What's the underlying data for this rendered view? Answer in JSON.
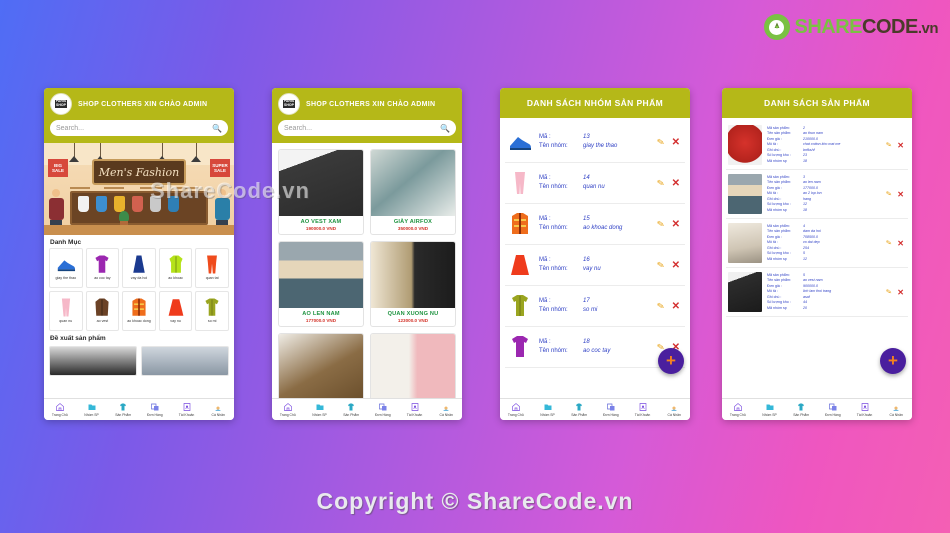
{
  "brand": {
    "share": "SHARE",
    "code": "CODE",
    "vn": ".vn",
    "mark_icon": "recycle-leaf-icon"
  },
  "watermarks": {
    "middle": "ShareCode.vn",
    "bottom": "Copyright © ShareCode.vn"
  },
  "bottom_nav": [
    {
      "label": "Trang Chủ",
      "icon": "home-icon"
    },
    {
      "label": "Nhóm SP",
      "icon": "folder-icon"
    },
    {
      "label": "Sản Phẩm",
      "icon": "tshirt-icon"
    },
    {
      "label": "Đơn Hàng",
      "icon": "orders-icon"
    },
    {
      "label": "Tài Khoản",
      "icon": "account-icon"
    },
    {
      "label": "Cá Nhân",
      "icon": "avatar-icon"
    }
  ],
  "phone1": {
    "header": {
      "title": "SHOP CLOTHERS XIN CHÀO ADMIN",
      "logo": "PARIS SHOP LOGO"
    },
    "search": {
      "placeholder": "Search...",
      "icon": "search-icon"
    },
    "banner": {
      "sign": "Men's Fashion",
      "sale_left": "BIG SALE",
      "sale_right": "SUPER SALE"
    },
    "section_categories": "Danh Mục",
    "categories": [
      {
        "label": "giay the thao",
        "icon": "sneaker-icon",
        "color": "#2a6fd6"
      },
      {
        "label": "ao coc tay",
        "icon": "tshirt-icon",
        "color": "#9b27b0"
      },
      {
        "label": "vay da hoi",
        "icon": "gown-icon",
        "color": "#1b3a8f"
      },
      {
        "label": "ao khoac",
        "icon": "jacket-icon",
        "color": "#b5e21a"
      },
      {
        "label": "quan tat",
        "icon": "tights-icon",
        "color": "#ef4b1c"
      },
      {
        "label": "quan nu",
        "icon": "pants-icon",
        "color": "#f6b8c8"
      },
      {
        "label": "ao vest",
        "icon": "coat-icon",
        "color": "#6b4226"
      },
      {
        "label": "ao khoac dong",
        "icon": "winter-jacket-icon",
        "color": "#ef6d1c"
      },
      {
        "label": "vay nu",
        "icon": "skirt-icon",
        "color": "#ef3b1c"
      },
      {
        "label": "so mi",
        "icon": "shirt-icon",
        "color": "#9aa520"
      }
    ],
    "section_suggested": "Đề xuất sản phẩm"
  },
  "phone2": {
    "header": {
      "title": "SHOP CLOTHERS XIN CHÀO ADMIN",
      "logo": "PARIS SHOP LOGO"
    },
    "search": {
      "placeholder": "Search...",
      "icon": "search-icon"
    },
    "products": [
      {
        "name": "AO VEST XAM",
        "price": "190000.0 VND",
        "image": "grey-blazer-photo"
      },
      {
        "name": "GIÀY AIRFOX",
        "price": "350000.0 VND",
        "image": "sneakers-photo"
      },
      {
        "name": "AO LEN NAM",
        "price": "177000.0 VND",
        "image": "striped-sweater-photo"
      },
      {
        "name": "QUAN XUONG NU",
        "price": "123000.0 VND",
        "image": "wide-trousers-photo"
      },
      {
        "name": "",
        "price": "",
        "image": "brown-coat-photo"
      },
      {
        "name": "",
        "price": "",
        "image": "pink-shirts-photo"
      }
    ]
  },
  "phone3": {
    "header_title": "DANH SÁCH NHÓM SẢN PHẨM",
    "labels": {
      "ma": "Mã :",
      "ten_nhom": "Tên nhóm:"
    },
    "groups": [
      {
        "ma": "13",
        "ten_nhom": "giay the thao",
        "icon": "sneaker-icon",
        "color": "#2a6fd6"
      },
      {
        "ma": "14",
        "ten_nhom": "quan nu",
        "icon": "pants-icon",
        "color": "#f6b8c8"
      },
      {
        "ma": "15",
        "ten_nhom": "ao khoac dong",
        "icon": "winter-jacket-icon",
        "color": "#ef6d1c"
      },
      {
        "ma": "16",
        "ten_nhom": "vay nu",
        "icon": "skirt-icon",
        "color": "#ef3b1c"
      },
      {
        "ma": "17",
        "ten_nhom": "so mi",
        "icon": "shirt-icon",
        "color": "#9aa520"
      },
      {
        "ma": "18",
        "ten_nhom": "ao coc tay",
        "icon": "tshirt-icon",
        "color": "#9b27b0"
      }
    ],
    "edit_icon": "pencil-icon",
    "delete_icon": "close-x-icon",
    "fab": "+"
  },
  "phone4": {
    "header_title": "DANH SÁCH  SẢN PHẨM",
    "labels": {
      "ma_sp": "Mã sản phẩm:",
      "ten_sp": "Tên sản phẩm:",
      "don_gia": "Đơn giá :",
      "mo_ta": "Mô tả :",
      "ghi_chu": "Ghi chú :",
      "so_luong": "Số lượng kho :",
      "ma_nhom": "Mã nhóm sp"
    },
    "products": [
      {
        "ma_sp": "2",
        "ten_sp": "ao thun nam",
        "don_gia": "210000.0",
        "mo_ta": "chat cotton kho mat me",
        "ghi_chu": "bnfkshf",
        "so_luong": "23",
        "ma_nhom": "18",
        "image": "red-tshirt-photo"
      },
      {
        "ma_sp": "3",
        "ten_sp": "ao len nam",
        "don_gia": "177000.0",
        "mo_ta": "ao 2 lop lon",
        "ghi_chu": "hang",
        "so_luong": "12",
        "ma_nhom": "18",
        "image": "striped-sweater-photo"
      },
      {
        "ma_sp": "4",
        "ten_sp": "dam da hoi",
        "don_gia": "708500.0",
        "mo_ta": "vo dai dep",
        "ghi_chu": "254",
        "so_luong": "5",
        "ma_nhom": "12",
        "image": "beige-dress-photo"
      },
      {
        "ma_sp": "5",
        "ten_sp": "ao vest nam",
        "don_gia": "900000.0",
        "mo_ta": "lich lam thoi trang",
        "ghi_chu": "asaf",
        "so_luong": "44",
        "ma_nhom": "20",
        "image": "black-blazer-photo"
      }
    ],
    "edit_icon": "pencil-icon",
    "delete_icon": "close-x-icon",
    "fab": "+"
  },
  "colors": {
    "header_olive": "#b5b818",
    "price_red": "#d3342a",
    "name_green": "#1f9340",
    "label_blue": "#2d3ec4",
    "fab_purple": "#4a1f9e",
    "fab_orange": "#f5821f"
  }
}
